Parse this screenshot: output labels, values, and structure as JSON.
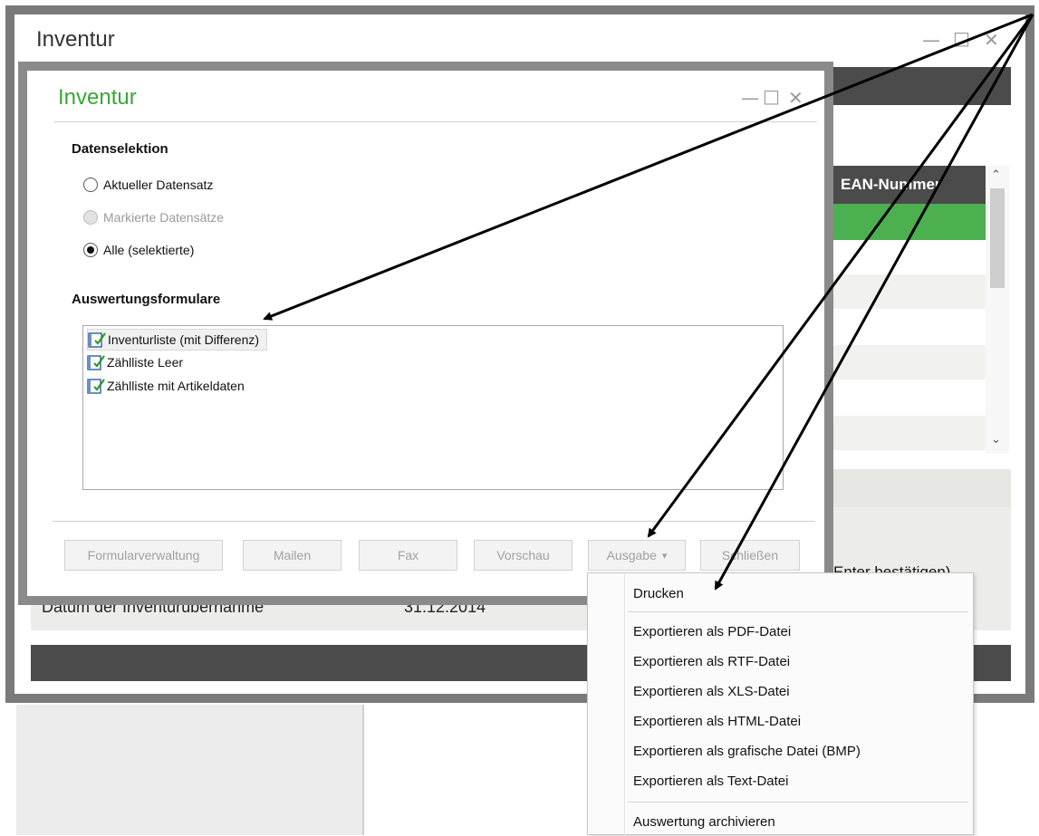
{
  "outer_window": {
    "title": "Inventur",
    "minimize_glyph": "—",
    "maximize_glyph": "□",
    "close_glyph": "✕",
    "column_header": "EAN-Nummer",
    "status_text": "Enter bestätigen)",
    "date_label": "Datum der Inventurübernahme",
    "date_value": "31.12.2014"
  },
  "dialog": {
    "title": "Inventur",
    "minimize_glyph": "—",
    "maximize_glyph": "□",
    "close_glyph": "✕",
    "section_selection": "Datenselektion",
    "radios": [
      {
        "label": "Aktueller Datensatz",
        "checked": false,
        "disabled": false
      },
      {
        "label": "Markierte Datensätze",
        "checked": false,
        "disabled": true
      },
      {
        "label": "Alle (selektierte)",
        "checked": true,
        "disabled": false
      }
    ],
    "section_forms": "Auswertungsformulare",
    "forms": [
      {
        "label": "Inventurliste (mit Differenz)",
        "icon": "form-book-icon",
        "selected": true
      },
      {
        "label": "Zählliste Leer",
        "icon": "form-book-icon",
        "selected": false
      },
      {
        "label": "Zählliste mit Artikeldaten",
        "icon": "form-book-icon",
        "selected": false
      }
    ],
    "buttons": {
      "formularverwaltung": "Formularverwaltung",
      "mailen": "Mailen",
      "fax": "Fax",
      "vorschau": "Vorschau",
      "ausgabe": "Ausgabe",
      "ausgabe_arrow": "▾",
      "schliessen": "Schließen"
    }
  },
  "output_menu": {
    "items": [
      "Drucken",
      "Exportieren als PDF-Datei",
      "Exportieren als RTF-Datei",
      "Exportieren als XLS-Datei",
      "Exportieren als HTML-Datei",
      "Exportieren als grafische Datei (BMP)",
      "Exportieren als Text-Datei",
      "Auswertung archivieren"
    ]
  },
  "colors": {
    "accent_green": "#3aa636",
    "selected_row": "#4caf50",
    "dark_bar": "#4b4b4b"
  }
}
